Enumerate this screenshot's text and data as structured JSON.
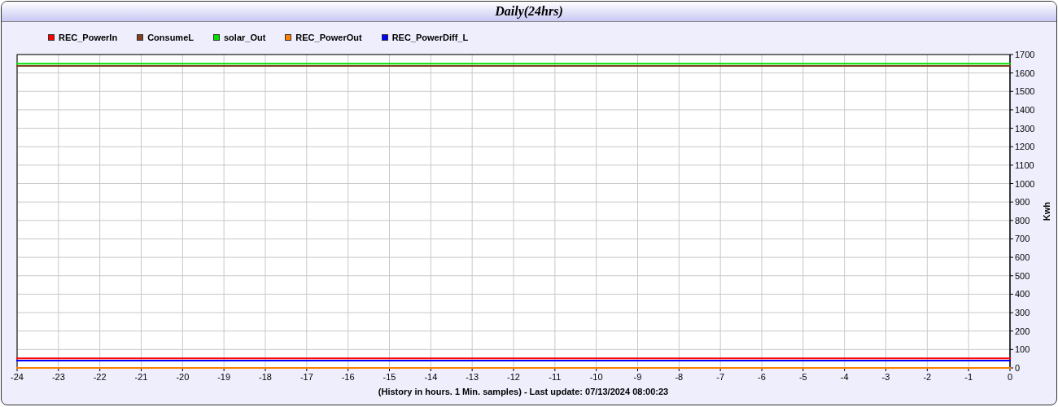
{
  "panel": {
    "title": "Daily(24hrs)"
  },
  "chart_data": {
    "type": "line",
    "xlabel": "(History in hours. 1 Min. samples) - Last update: 07/13/2024 08:00:23",
    "ylabel": "Kwh",
    "x": [
      -24,
      0
    ],
    "series": [
      {
        "name": "REC_PowerIn",
        "color": "#ff0000",
        "values": [
          52,
          52
        ]
      },
      {
        "name": "ConsumeL",
        "color": "#804020",
        "values": [
          1638,
          1638
        ]
      },
      {
        "name": "solar_Out",
        "color": "#00e000",
        "values": [
          1650,
          1650
        ]
      },
      {
        "name": "REC_PowerOut",
        "color": "#ff8000",
        "values": [
          0,
          0
        ]
      },
      {
        "name": "REC_PowerDiff_L",
        "color": "#0000ff",
        "values": [
          40,
          40
        ]
      }
    ],
    "grid": true,
    "xlim": [
      -24,
      0
    ],
    "ylim": [
      0,
      1700
    ],
    "xticks": [
      -24,
      -23,
      -22,
      -21,
      -20,
      -19,
      -18,
      -17,
      -16,
      -15,
      -14,
      -13,
      -12,
      -11,
      -10,
      -9,
      -8,
      -7,
      -6,
      -5,
      -4,
      -3,
      -2,
      -1,
      0
    ],
    "yticks": [
      0,
      100,
      200,
      300,
      400,
      500,
      600,
      700,
      800,
      900,
      1000,
      1100,
      1200,
      1300,
      1400,
      1500,
      1600,
      1700
    ]
  }
}
